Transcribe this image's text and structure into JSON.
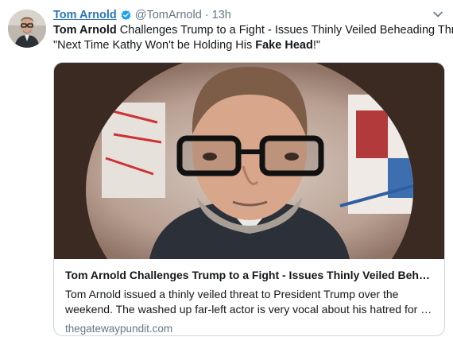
{
  "tweet": {
    "author_name": "Tom Arnold",
    "author_handle": "@TomArnold",
    "separator": "·",
    "timestamp": "13h",
    "verified_icon": "verified-badge-icon",
    "menu_icon": "chevron-down-icon",
    "text_line1_bold": "Tom Arnold",
    "text_line1_rest": " Challenges Trump to a Fight - Issues Thinly Veiled Beheading Threat",
    "text_line2_pre": "\"Next Time Kathy Won't be Holding His ",
    "text_line2_bold": "Fake Head",
    "text_line2_post": "!\""
  },
  "card": {
    "title": "Tom Arnold Challenges Trump to a Fight - Issues Thinly Veiled Behea...",
    "description_line1": "Tom Arnold issued a thinly veiled threat to President Trump over the",
    "description_line2": "weekend. The washed up far-left actor is very vocal about his hatred for Pr...",
    "domain": "thegatewaypundit.com"
  },
  "colors": {
    "link_blue": "#2a76b8",
    "verified_blue": "#1da1f2",
    "muted_gray": "#657786",
    "border": "#ccd6dd"
  }
}
